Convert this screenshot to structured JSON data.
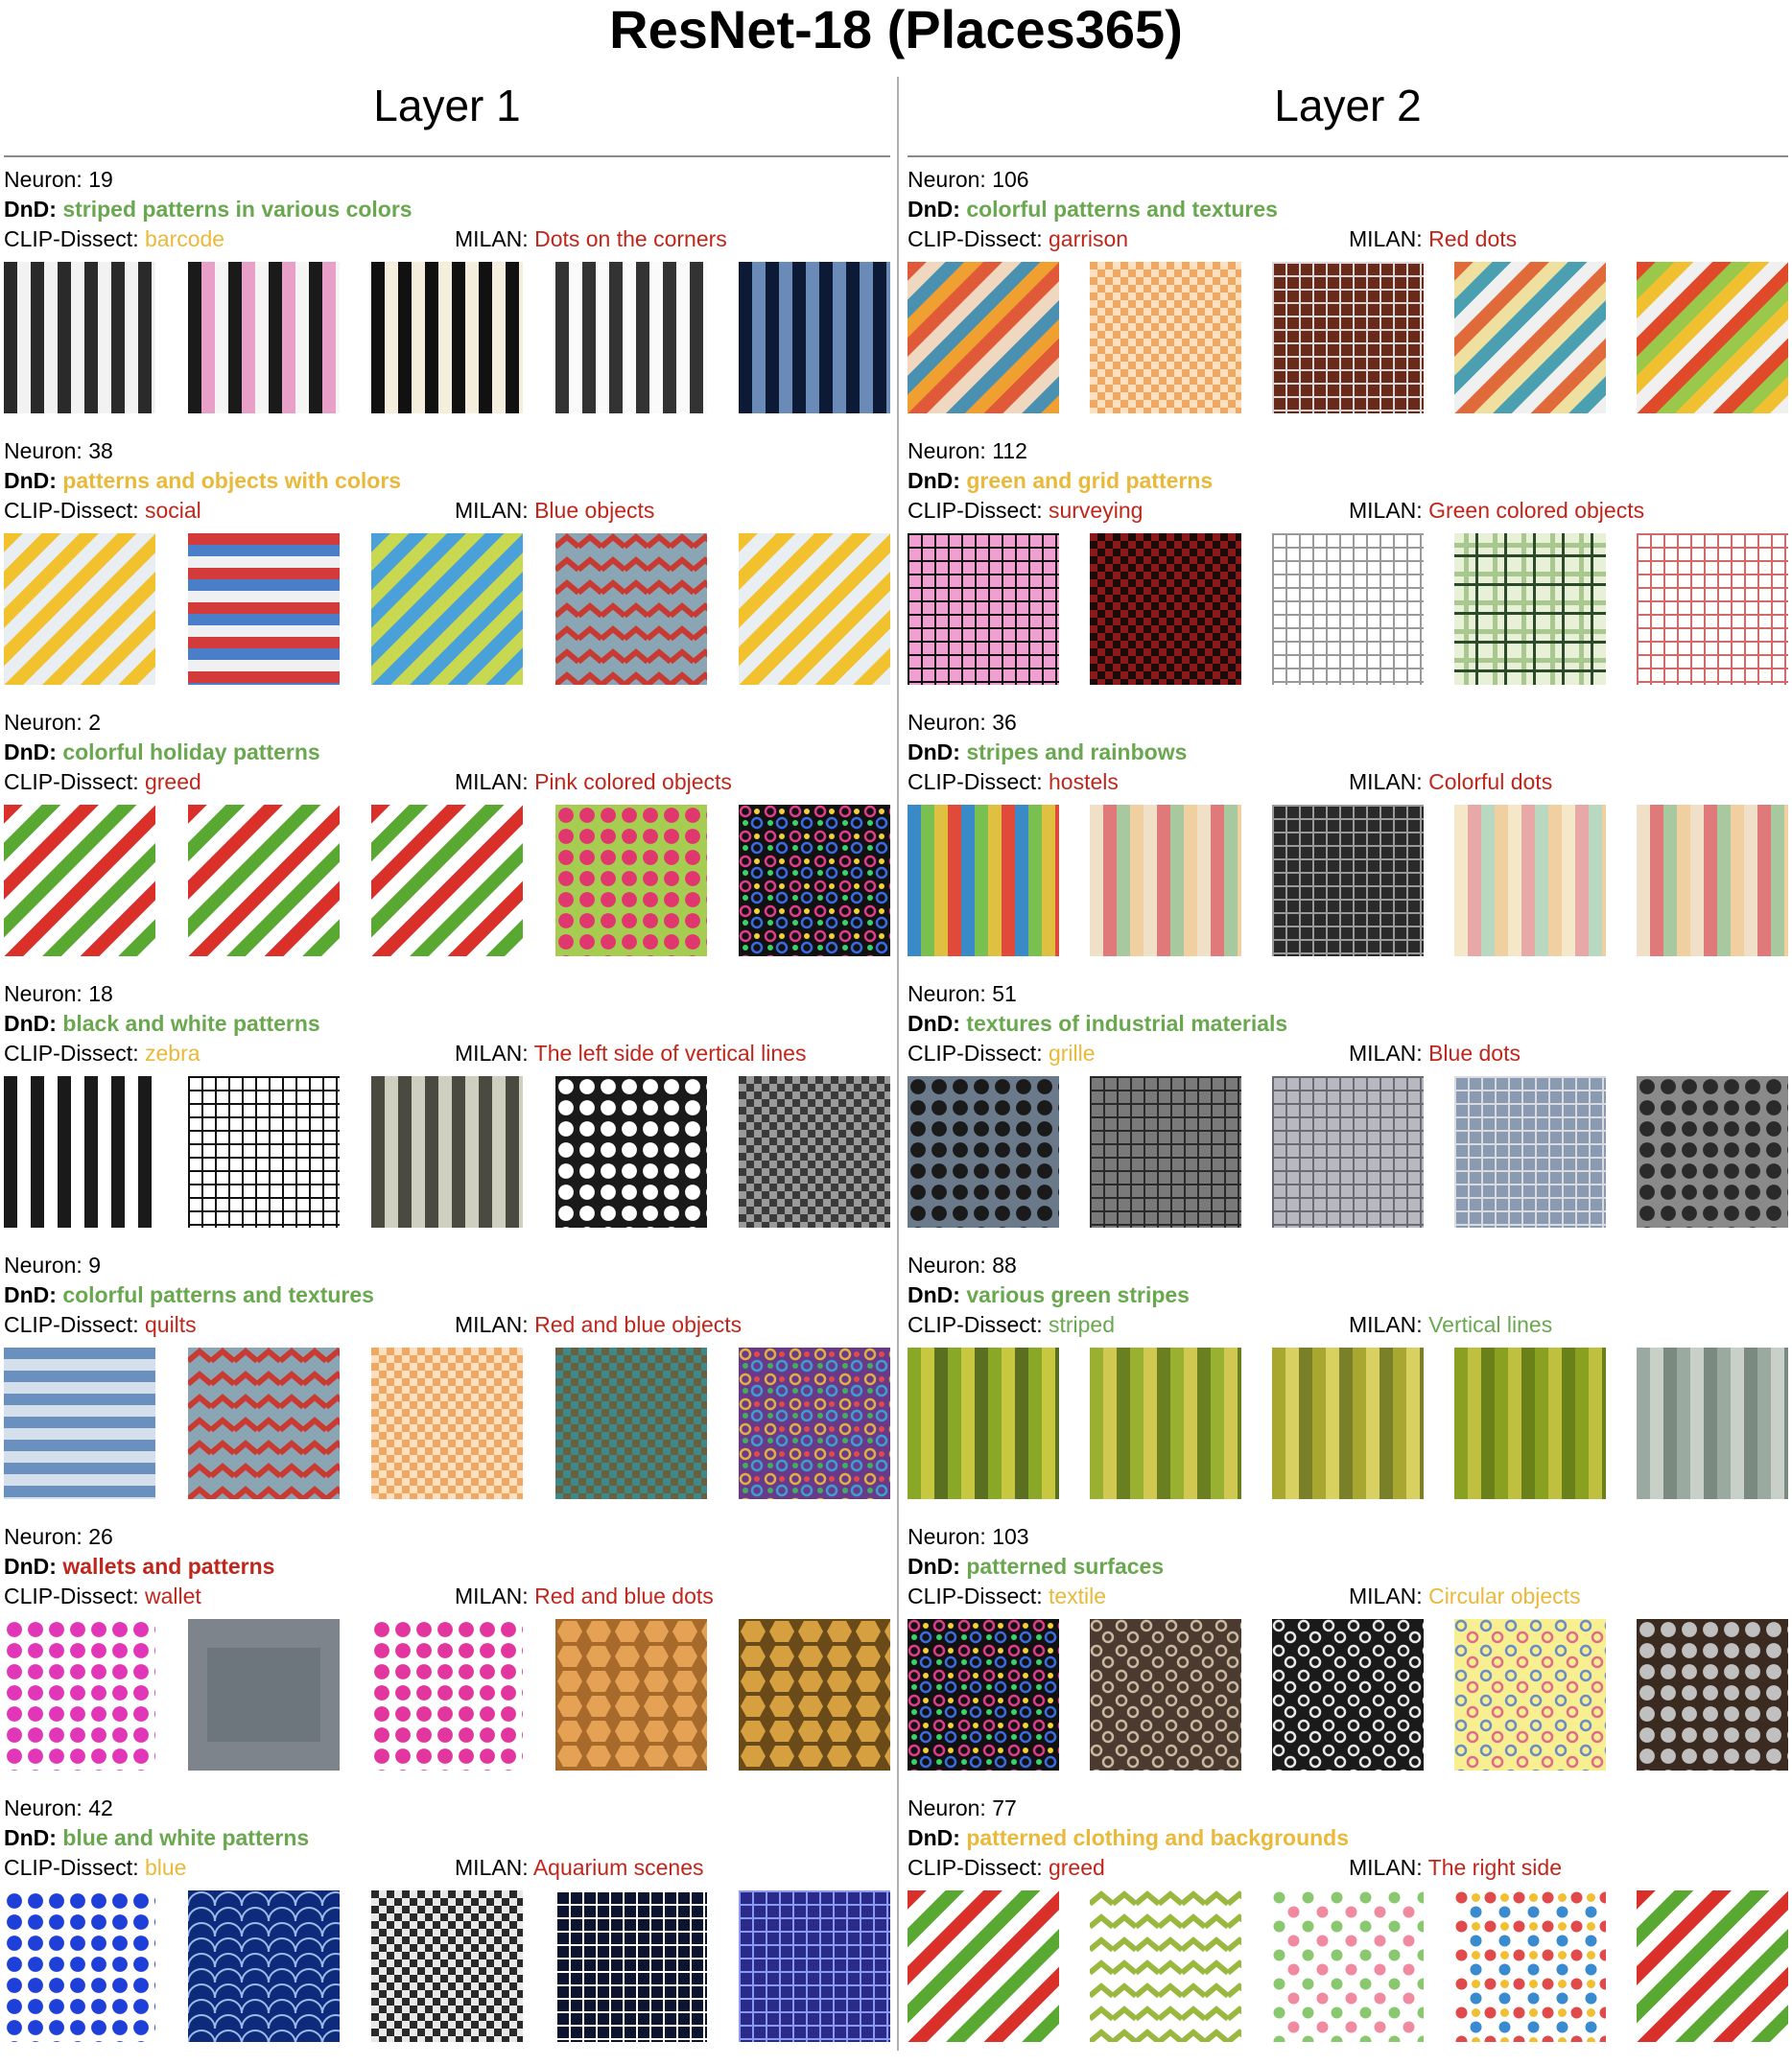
{
  "title": "ResNet-18 (Places365)",
  "colors": {
    "green": "#6aa84f",
    "red": "#c0261b",
    "yellow": "#eab93a"
  },
  "labels": {
    "neuron": "Neuron: ",
    "dnd": "DnD: ",
    "clip": "CLIP-Dissect: ",
    "milan": "MILAN: "
  },
  "layers": [
    {
      "title": "Layer 1",
      "neurons": [
        {
          "id": "19",
          "dnd": "striped patterns in various colors",
          "dnd_color": "green",
          "clip": "barcode",
          "clip_color": "yellow",
          "milan": "Dots on the corners",
          "milan_color": "red",
          "images": [
            {
              "p": "vstripes",
              "c": [
                "#2a2a2a",
                "#f2f2f2"
              ]
            },
            {
              "p": "vstripes",
              "c": [
                "#1a1a1a",
                "#e8a0c8",
                "#f5f5f5"
              ]
            },
            {
              "p": "vstripes",
              "c": [
                "#111111",
                "#f4efdc"
              ]
            },
            {
              "p": "vstripes",
              "c": [
                "#333333",
                "#fafafa"
              ]
            },
            {
              "p": "vstripes",
              "c": [
                "#0c1a35",
                "#6a8bb8"
              ]
            }
          ]
        },
        {
          "id": "38",
          "dnd": "patterns and objects with colors",
          "dnd_color": "yellow",
          "clip": "social",
          "clip_color": "red",
          "milan": "Blue objects",
          "milan_color": "red",
          "images": [
            {
              "p": "diag",
              "c": [
                "#f2c12e",
                "#e8eef2"
              ]
            },
            {
              "p": "hstripes",
              "c": [
                "#d33a3a",
                "#4a7ec9",
                "#eef0f2"
              ]
            },
            {
              "p": "diag",
              "c": [
                "#4aa0d8",
                "#c8d850"
              ]
            },
            {
              "p": "zigzag",
              "c": [
                "#c83a32",
                "#8aa6b5"
              ]
            },
            {
              "p": "diag",
              "c": [
                "#f2c12e",
                "#e8eef2"
              ]
            }
          ]
        },
        {
          "id": "2",
          "dnd": "colorful holiday patterns",
          "dnd_color": "green",
          "clip": "greed",
          "clip_color": "red",
          "milan": "Pink colored objects",
          "milan_color": "red",
          "images": [
            {
              "p": "diag",
              "c": [
                "#d9302a",
                "#ffffff",
                "#58a832",
                "#ffffff"
              ]
            },
            {
              "p": "diag",
              "c": [
                "#d9302a",
                "#ffffff",
                "#58a832",
                "#ffffff"
              ]
            },
            {
              "p": "diag",
              "c": [
                "#d9302a",
                "#ffffff",
                "#58a832",
                "#ffffff"
              ]
            },
            {
              "p": "dots",
              "c": [
                "#a6cc52",
                "#e0376e"
              ]
            },
            {
              "p": "swirl",
              "c": [
                "#111111",
                "#e33b8c",
                "#3b6be3",
                "#f2d13b",
                "#3bd16b"
              ]
            }
          ]
        },
        {
          "id": "18",
          "dnd": "black and white patterns",
          "dnd_color": "green",
          "clip": "zebra",
          "clip_color": "yellow",
          "milan": "The left side of vertical lines",
          "milan_color": "red",
          "images": [
            {
              "p": "vstripes",
              "c": [
                "#1a1a1a",
                "#ffffff"
              ]
            },
            {
              "p": "grid",
              "c": [
                "#ffffff",
                "#111111"
              ]
            },
            {
              "p": "vstripes",
              "c": [
                "#4a4a40",
                "#cfcfc0"
              ]
            },
            {
              "p": "dots",
              "c": [
                "#1a1a1a",
                "#ffffff"
              ]
            },
            {
              "p": "checker",
              "c": [
                "#3a3a3a",
                "#9a9a9a"
              ]
            }
          ]
        },
        {
          "id": "9",
          "dnd": "colorful patterns and textures",
          "dnd_color": "green",
          "clip": "quilts",
          "clip_color": "red",
          "milan": "Red and blue objects",
          "milan_color": "red",
          "images": [
            {
              "p": "hstripes",
              "c": [
                "#6a90c0",
                "#d6e0ec"
              ]
            },
            {
              "p": "zigzag",
              "c": [
                "#c83a32",
                "#8aa6b5"
              ]
            },
            {
              "p": "checker",
              "c": [
                "#f0a860",
                "#fce0c0"
              ]
            },
            {
              "p": "checker",
              "c": [
                "#6a6040",
                "#3a8a8a"
              ]
            },
            {
              "p": "swirl",
              "c": [
                "#6a3a8a",
                "#e0b040",
                "#3aa0d0",
                "#e04a4a",
                "#40b060"
              ]
            }
          ]
        },
        {
          "id": "26",
          "dnd": "wallets and patterns",
          "dnd_color": "red",
          "clip": "wallet",
          "clip_color": "red",
          "milan": "Red and blue dots",
          "milan_color": "red",
          "images": [
            {
              "p": "dots",
              "c": [
                "#ffffff",
                "#e236b8"
              ]
            },
            {
              "p": "solid",
              "c": [
                "#7d848c",
                "#5e656d"
              ]
            },
            {
              "p": "dots",
              "c": [
                "#ffffff",
                "#e3359e"
              ]
            },
            {
              "p": "hex",
              "c": [
                "#a86a2a",
                "#e6a254"
              ]
            },
            {
              "p": "hex",
              "c": [
                "#6a4a18",
                "#d6a040"
              ]
            }
          ]
        },
        {
          "id": "42",
          "dnd": "blue and white patterns",
          "dnd_color": "green",
          "clip": "blue",
          "clip_color": "yellow",
          "milan": "Aquarium scenes",
          "milan_color": "red",
          "images": [
            {
              "p": "dots",
              "c": [
                "#ffffff",
                "#1f3fd9"
              ]
            },
            {
              "p": "scales",
              "c": [
                "#0e2a7a",
                "#9ab8e8"
              ]
            },
            {
              "p": "checker",
              "c": [
                "#2a2a2a",
                "#e8e8e8"
              ]
            },
            {
              "p": "grid",
              "c": [
                "#0d1430",
                "#ffffff"
              ]
            },
            {
              "p": "grid",
              "c": [
                "#2a2a8a",
                "#8a9af0"
              ]
            }
          ]
        }
      ]
    },
    {
      "title": "Layer 2",
      "neurons": [
        {
          "id": "106",
          "dnd": "colorful patterns and textures",
          "dnd_color": "green",
          "clip": "garrison",
          "clip_color": "red",
          "milan": "Red dots",
          "milan_color": "red",
          "images": [
            {
              "p": "diag",
              "c": [
                "#e05a3a",
                "#f0d8c0",
                "#4a90b0",
                "#f0a030"
              ]
            },
            {
              "p": "checker",
              "c": [
                "#f0a860",
                "#fce0c0"
              ]
            },
            {
              "p": "grid",
              "c": [
                "#6a2a1a",
                "#d8d8d8"
              ]
            },
            {
              "p": "diag",
              "c": [
                "#e06a3a",
                "#f0e0a0",
                "#4aa0b0",
                "#f0f0f0"
              ]
            },
            {
              "p": "diag",
              "c": [
                "#e04a2a",
                "#9ac84a",
                "#f0c030",
                "#f0f0f0"
              ]
            }
          ]
        },
        {
          "id": "112",
          "dnd": "green and grid patterns",
          "dnd_color": "yellow",
          "clip": "surveying",
          "clip_color": "red",
          "milan": "Green colored objects",
          "milan_color": "red",
          "images": [
            {
              "p": "grid",
              "c": [
                "#f0a0d0",
                "#111111"
              ]
            },
            {
              "p": "checker",
              "c": [
                "#8a1a1a",
                "#1a0a0a"
              ]
            },
            {
              "p": "grid",
              "c": [
                "#ffffff",
                "#999999"
              ]
            },
            {
              "p": "plaid",
              "c": [
                "#e8f0d8",
                "#2a4a2a",
                "#a8c890"
              ]
            },
            {
              "p": "grid",
              "c": [
                "#ffffff",
                "#d06a6a"
              ]
            }
          ]
        },
        {
          "id": "36",
          "dnd": "stripes and rainbows",
          "dnd_color": "green",
          "clip": "hostels",
          "clip_color": "red",
          "milan": "Colorful dots",
          "milan_color": "red",
          "images": [
            {
              "p": "vstripes",
              "c": [
                "#3a8ac8",
                "#7ac050",
                "#e0c040",
                "#e04a3a"
              ]
            },
            {
              "p": "vstripes",
              "c": [
                "#f0e0c8",
                "#e07a7a",
                "#a8c8a0",
                "#f0d0a0"
              ]
            },
            {
              "p": "grid",
              "c": [
                "#2a2a2a",
                "#9a9a9a"
              ]
            },
            {
              "p": "vstripes",
              "c": [
                "#f4e8c8",
                "#e8a8a8",
                "#b8d8c0",
                "#f0d0a0"
              ]
            },
            {
              "p": "vstripes",
              "c": [
                "#f0e0c8",
                "#e07a7a",
                "#a8c8a0",
                "#f0d0a0"
              ]
            }
          ]
        },
        {
          "id": "51",
          "dnd": "textures of industrial materials",
          "dnd_color": "green",
          "clip": "grille",
          "clip_color": "yellow",
          "milan": "Blue dots",
          "milan_color": "red",
          "images": [
            {
              "p": "dots",
              "c": [
                "#6a7a8a",
                "#1a1a1a"
              ]
            },
            {
              "p": "grid",
              "c": [
                "#7a7a7a",
                "#2a2a2a"
              ]
            },
            {
              "p": "grid",
              "c": [
                "#b8b8c0",
                "#6a6a70"
              ]
            },
            {
              "p": "grid",
              "c": [
                "#8a9ab0",
                "#d8dce0"
              ]
            },
            {
              "p": "dots",
              "c": [
                "#8a8a8a",
                "#2a2a2a"
              ]
            }
          ]
        },
        {
          "id": "88",
          "dnd": "various green stripes",
          "dnd_color": "green",
          "clip": "striped",
          "clip_color": "green",
          "milan": "Vertical lines",
          "milan_color": "green",
          "images": [
            {
              "p": "vstripes",
              "c": [
                "#8aa828",
                "#c8c840",
                "#5a7020"
              ]
            },
            {
              "p": "vstripes",
              "c": [
                "#9ab030",
                "#d0c850",
                "#6a8020"
              ]
            },
            {
              "p": "vstripes",
              "c": [
                "#a8a830",
                "#d8d060",
                "#7a8028"
              ]
            },
            {
              "p": "vstripes",
              "c": [
                "#8aa020",
                "#c0c040",
                "#6a8018"
              ]
            },
            {
              "p": "vstripes",
              "c": [
                "#9aaaa0",
                "#c8d0c8",
                "#7a8a80"
              ]
            }
          ]
        },
        {
          "id": "103",
          "dnd": "patterned surfaces",
          "dnd_color": "green",
          "clip": "textile",
          "clip_color": "yellow",
          "milan": "Circular objects",
          "milan_color": "yellow",
          "images": [
            {
              "p": "swirl",
              "c": [
                "#111111",
                "#e33b8c",
                "#3b6be3",
                "#f2d13b",
                "#3bd16b"
              ]
            },
            {
              "p": "swirl",
              "c": [
                "#4a3a30",
                "#c8b8a0"
              ]
            },
            {
              "p": "swirl",
              "c": [
                "#1a1a1a",
                "#e8e8e8"
              ]
            },
            {
              "p": "swirl",
              "c": [
                "#f8f090",
                "#6a8ac8",
                "#e06a8a"
              ]
            },
            {
              "p": "dots",
              "c": [
                "#3a2a20",
                "#c0c0c0"
              ]
            }
          ]
        },
        {
          "id": "77",
          "dnd": "patterned clothing and backgrounds",
          "dnd_color": "yellow",
          "clip": "greed",
          "clip_color": "red",
          "milan": "The right side",
          "milan_color": "red",
          "images": [
            {
              "p": "diag",
              "c": [
                "#d9302a",
                "#ffffff",
                "#58a832",
                "#ffffff"
              ]
            },
            {
              "p": "zigzag",
              "c": [
                "#9ab840",
                "#ffffff"
              ]
            },
            {
              "p": "dots",
              "c": [
                "#ffffff",
                "#8ac870",
                "#f08aa0"
              ]
            },
            {
              "p": "dots",
              "c": [
                "#ffffff",
                "#e04a4a",
                "#3a8ad0",
                "#f0c030"
              ]
            },
            {
              "p": "diag",
              "c": [
                "#d9302a",
                "#ffffff",
                "#58a832",
                "#ffffff"
              ]
            }
          ]
        }
      ]
    }
  ]
}
